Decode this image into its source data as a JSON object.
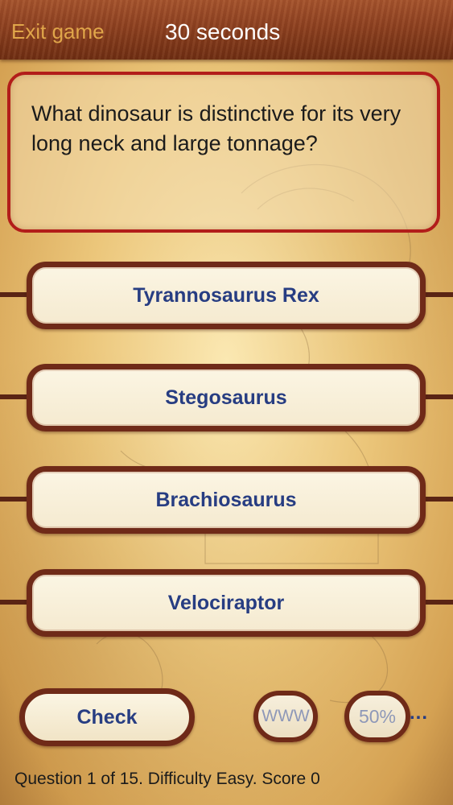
{
  "header": {
    "exit_label": "Exit game",
    "timer_text": "30 seconds"
  },
  "question": {
    "text": "What dinosaur is distinctive for its very long neck and large tonnage?"
  },
  "answers": [
    {
      "label": "Tyrannosaurus Rex"
    },
    {
      "label": "Stegosaurus"
    },
    {
      "label": "Brachiosaurus"
    },
    {
      "label": "Velociraptor"
    }
  ],
  "controls": {
    "check_label": "Check",
    "www_label": "WWW",
    "fifty_label": "50%",
    "more_label": "..."
  },
  "status": {
    "text": "Question 1 of 15. Difficulty Easy. Score 0"
  },
  "colors": {
    "header_bar": "#8c3f1f",
    "exit_text": "#e0a64a",
    "question_border": "#b21d1a",
    "button_border": "#6f2a18",
    "answer_text": "#273d82",
    "lifeline_text": "#8e98b8"
  }
}
